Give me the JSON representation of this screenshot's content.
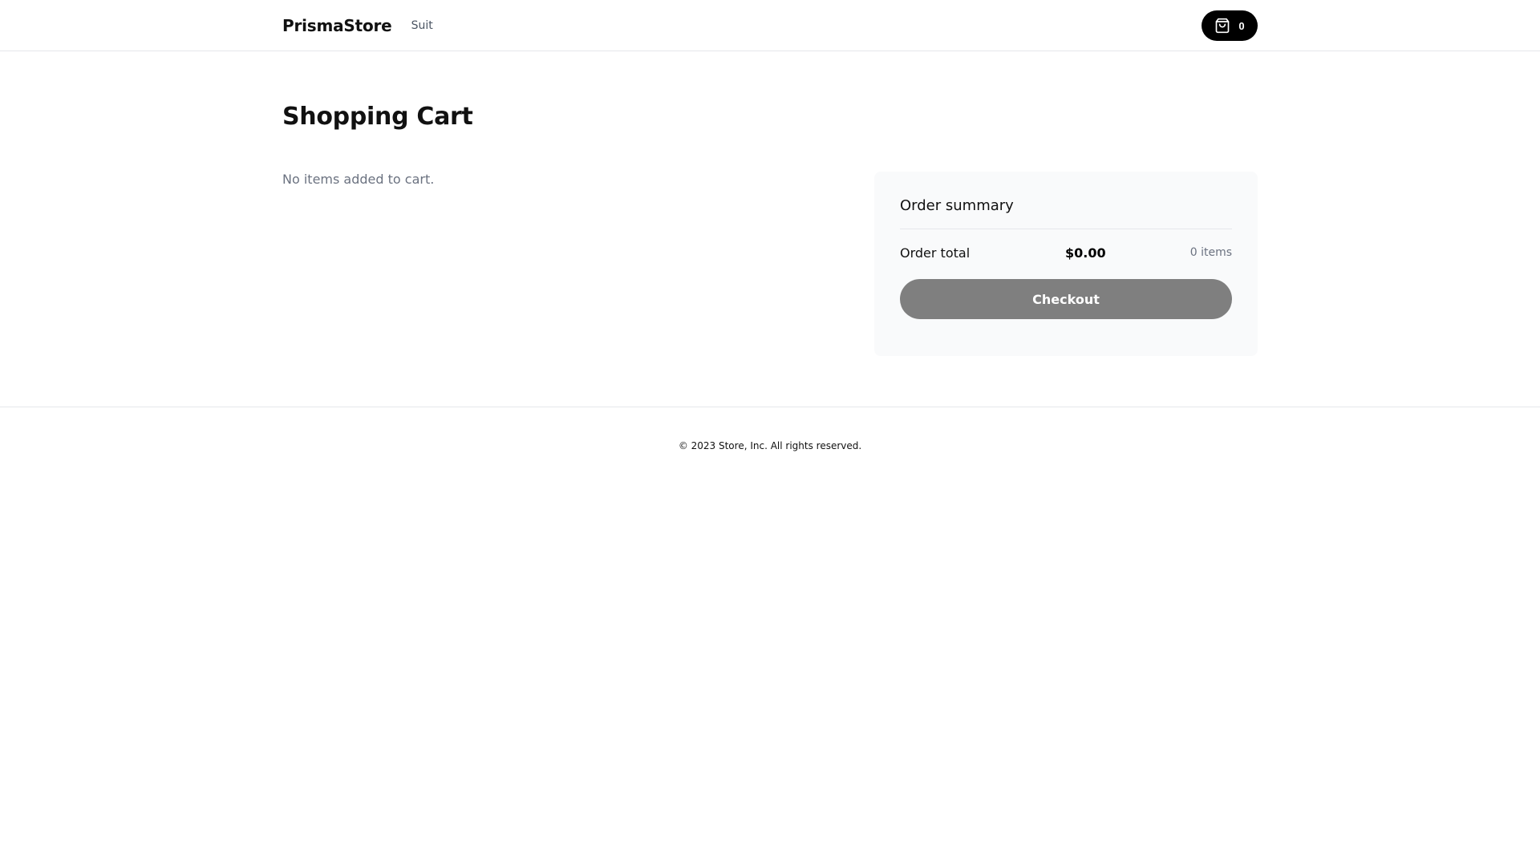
{
  "header": {
    "brand": "PrismaStore",
    "nav_links": [
      "Suit"
    ],
    "cart": {
      "icon": "shopping-bag-icon",
      "count": "0"
    }
  },
  "main": {
    "title": "Shopping Cart",
    "empty_message": "No items added to cart."
  },
  "summary": {
    "title": "Order summary",
    "total_label": "Order total",
    "total_value": "$0.00",
    "item_count": "0 items",
    "checkout_label": "Checkout"
  },
  "footer": {
    "copyright": "© 2023 Store, Inc. All rights reserved."
  },
  "colors": {
    "accent": "#000000",
    "checkout_disabled": "#7f7f7f",
    "summary_background": "#f9fafb",
    "muted_text": "#6b7280"
  }
}
